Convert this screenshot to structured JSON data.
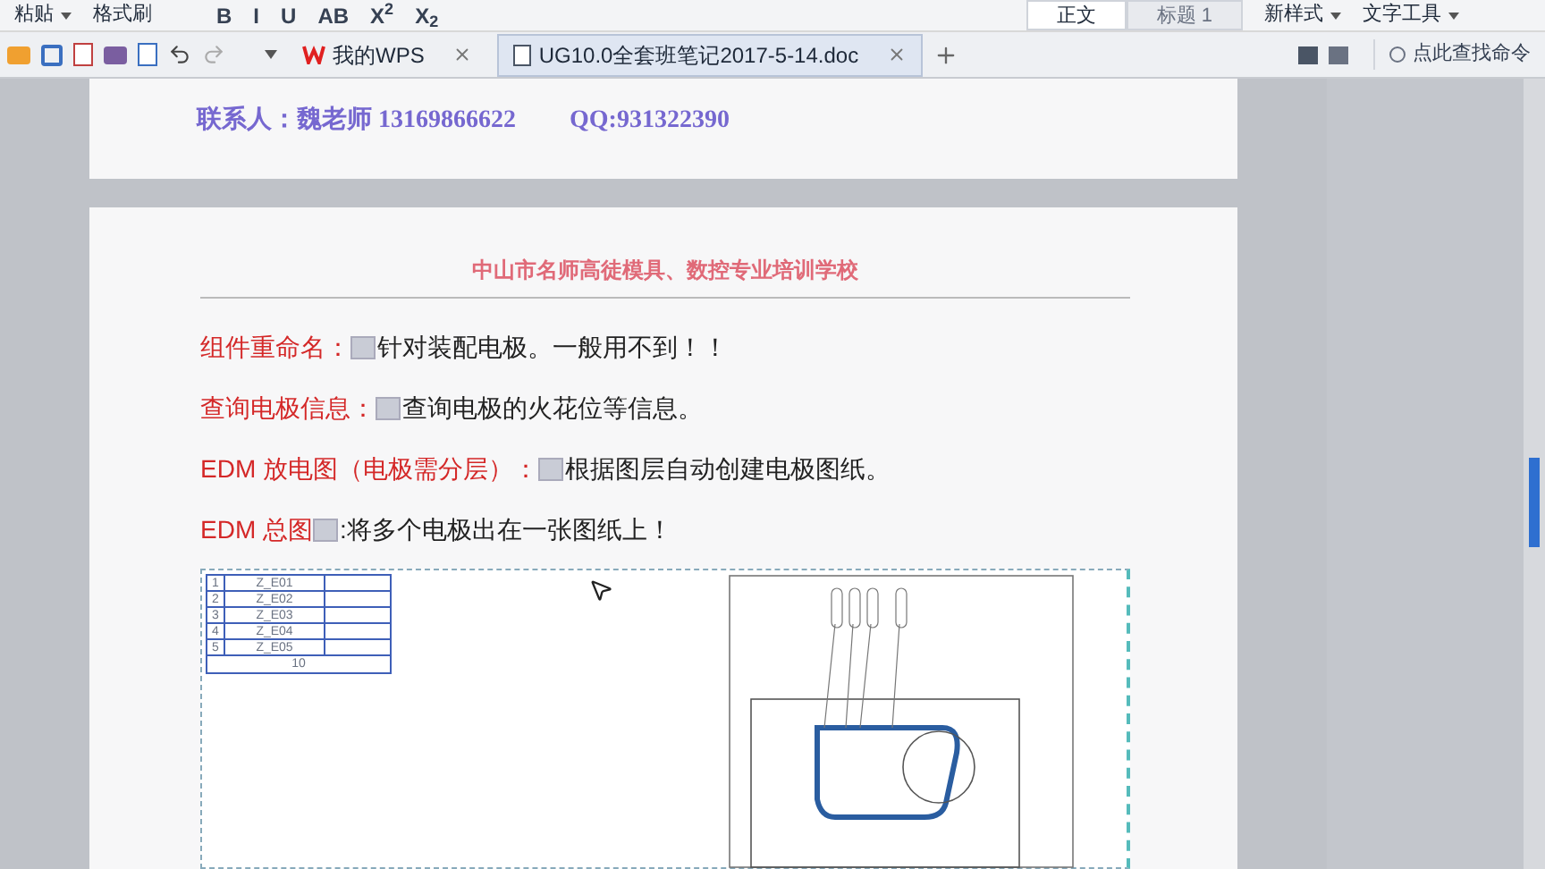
{
  "ribbon": {
    "paste": "粘贴",
    "format_painter": "格式刷",
    "format_buttons": [
      "B",
      "I",
      "U",
      "AB",
      "X$^{2}$",
      "X$_{2}$"
    ],
    "styles": [
      {
        "label": "正文",
        "selected": true
      },
      {
        "label": "标题 1",
        "selected": false
      }
    ],
    "new_style": "新样式",
    "text_tools": "文字工具"
  },
  "tabs": [
    {
      "label": "我的WPS",
      "kind": "wps",
      "selected": false
    },
    {
      "label": "UG10.0全套班笔记2017-5-14.doc",
      "kind": "doc",
      "selected": true
    }
  ],
  "command_search": {
    "placeholder": "点此查找命令"
  },
  "page1": {
    "contact": "联系人：魏老师 13169866622",
    "qq": "QQ:931322390"
  },
  "page2": {
    "header": "中山市名师高徒模具、数控专业培训学校",
    "lines": [
      {
        "label": "组件重命名：",
        "text": "针对装配电极。一般用不到！！"
      },
      {
        "label": "查询电极信息：",
        "text": "查询电极的火花位等信息。"
      },
      {
        "label": "EDM 放电图（电极需分层）：",
        "text": "根据图层自动创建电极图纸。"
      },
      {
        "label": "EDM 总图",
        "text": ":将多个电极出在一张图纸上！"
      }
    ],
    "drawing_table": [
      {
        "no": "1",
        "code": "Z_E01"
      },
      {
        "no": "2",
        "code": "Z_E02"
      },
      {
        "no": "3",
        "code": "Z_E03"
      },
      {
        "no": "4",
        "code": "Z_E04"
      },
      {
        "no": "5",
        "code": "Z_E05"
      }
    ],
    "drawing_total": "10"
  }
}
